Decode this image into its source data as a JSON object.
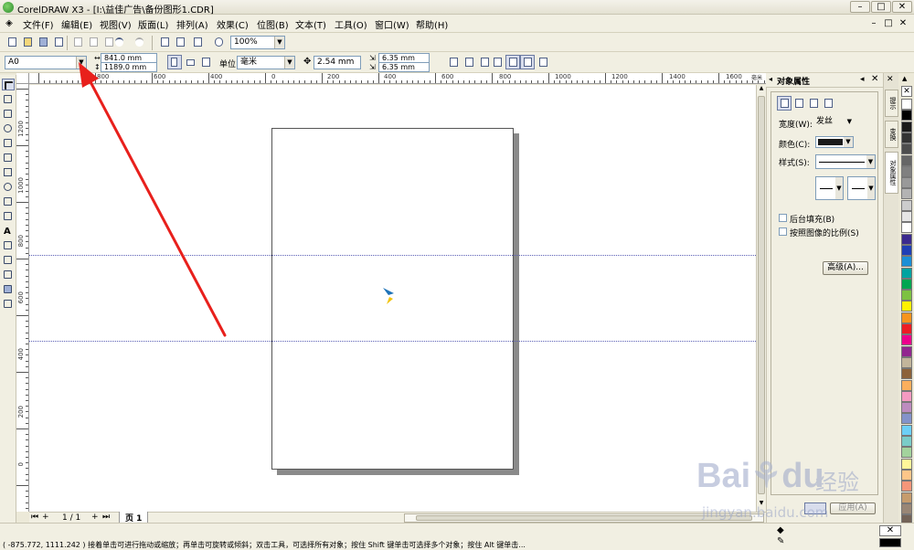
{
  "window": {
    "title": "CorelDRAW X3 - [I:\\益佳广告\\备份图形1.CDR]",
    "controls": [
      "–",
      "□",
      "✕"
    ],
    "doc_controls": [
      "–",
      "□",
      "✕"
    ]
  },
  "menu": {
    "items": [
      "文件(F)",
      "编辑(E)",
      "视图(V)",
      "版面(L)",
      "排列(A)",
      "效果(C)",
      "位图(B)",
      "文本(T)",
      "工具(O)",
      "窗口(W)",
      "帮助(H)"
    ]
  },
  "standard_toolbar": {
    "zoom_value": "100%"
  },
  "property_bar": {
    "paper_preset": "A0",
    "paper_width": "841.0 mm",
    "paper_height": "1189.0 mm",
    "units_label": "单位:",
    "units_value": "毫米",
    "nudge_value": "2.54 mm",
    "dup_x": "6.35 mm",
    "dup_y": "6.35 mm"
  },
  "rulers": {
    "horizontal_labels": [
      "800",
      "600",
      "400",
      "200",
      "0",
      "200",
      "400",
      "600",
      "800",
      "1000",
      "1200",
      "1400",
      "1600"
    ],
    "horizontal_unit": "毫米",
    "vertical_labels": [
      "1200",
      "1000",
      "800",
      "600",
      "400",
      "200",
      "0"
    ]
  },
  "page_nav": {
    "counter": "1 / 1",
    "page_tab": "页 1"
  },
  "docker": {
    "title": "对象属性",
    "width_label": "宽度(W):",
    "width_value": "发丝",
    "color_label": "颜色(C):",
    "style_label": "样式(S):",
    "behind_fill_label": "后台填充(B)",
    "scale_with_image_label": "按照图像的比例(S)",
    "advanced_button": "高级(A)...",
    "apply_button": "应用(A)",
    "side_tabs": [
      "提示",
      "变换",
      "对象属性"
    ]
  },
  "palette": {
    "colors": [
      "#ffffff",
      "#000000",
      "#1a1a1a",
      "#333333",
      "#4d4d4d",
      "#666666",
      "#808080",
      "#999999",
      "#b3b3b3",
      "#cccccc",
      "#e6e6e6",
      "#ffffff",
      "#3b2a8f",
      "#1f3fb5",
      "#1a8fd6",
      "#00a3a0",
      "#00a650",
      "#7dc242",
      "#fff200",
      "#f7941d",
      "#ed1c24",
      "#ec008c",
      "#92278f",
      "#c2b59b",
      "#8c6239",
      "#fbaf5d",
      "#f49ac1",
      "#bd8cbf",
      "#8493ca",
      "#6dcff6",
      "#7accc8",
      "#a3d39c",
      "#fff799",
      "#fdc689",
      "#f69679",
      "#c69c6d",
      "#998675",
      "#736357",
      "#534741",
      "#362f2d"
    ]
  },
  "status": {
    "text": "( -875.772, 1111.242 )  接着单击可进行拖动或缩放；再单击可旋转或倾斜；双击工具，可选择所有对象；按住 Shift 键单击可选择多个对象；按住 Alt 键单击..."
  },
  "watermark": {
    "brand": "Bai",
    "brand2": "du",
    "cn": "经验",
    "url": "jingyan.baidu.com"
  },
  "colors": {
    "arrow": "#e8201c",
    "guide": "#5a5fb5"
  }
}
